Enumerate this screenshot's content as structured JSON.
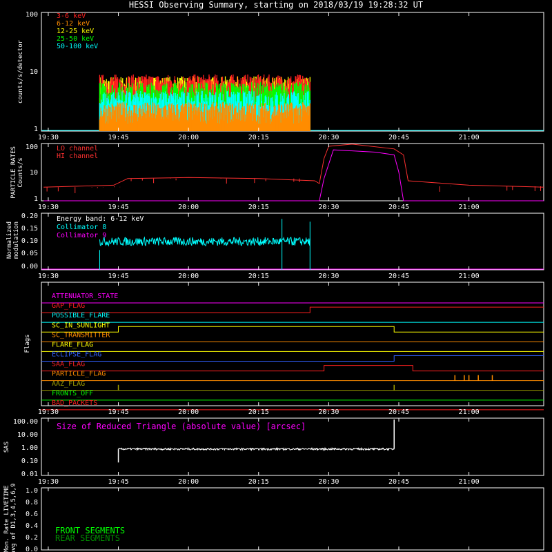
{
  "title": "HESSI Observing Summary, starting on 2018/03/19 19:28:32 UT",
  "time_ticks": [
    "19:30",
    "19:45",
    "20:00",
    "20:15",
    "20:30",
    "20:45",
    "21:00"
  ],
  "chart_data": [
    {
      "type": "line",
      "panel": "count-rates",
      "ylabel": "counts/s/detector",
      "yscale": "log",
      "ylim": [
        1,
        100
      ],
      "yticks": [
        "100",
        "10",
        "1"
      ],
      "x_range": [
        "19:28:32",
        "21:16"
      ],
      "series": [
        {
          "name": "3-6 keV",
          "color": "#ff2020",
          "start": "19:41",
          "end": "20:26",
          "typical": 6.5,
          "max": 9
        },
        {
          "name": "6-12 keV",
          "color": "#ff8c00",
          "start": "19:41",
          "end": "20:26",
          "typical": 2.2,
          "max": 4
        },
        {
          "name": "12-25 keV",
          "color": "#ffff00",
          "start": "19:41",
          "end": "20:26",
          "typical": 6.0,
          "max": 9
        },
        {
          "name": "25-50 keV",
          "color": "#00ff00",
          "start": "19:41",
          "end": "20:26",
          "typical": 4.8,
          "max": 7
        },
        {
          "name": "50-100 keV",
          "color": "#00ffff",
          "start": "19:41",
          "end": "20:26",
          "typical": 3.4,
          "max": 5
        }
      ]
    },
    {
      "type": "line",
      "panel": "particle-rates",
      "ylabel": "PARTICLE RATES Counts/s",
      "yscale": "log",
      "ylim": [
        1,
        100
      ],
      "yticks": [
        "100",
        "10",
        "1"
      ],
      "series": [
        {
          "name": "LO channel",
          "color": "#ff3030",
          "points": [
            [
              "19:29",
              3
            ],
            [
              "19:44",
              3.5
            ],
            [
              "19:47",
              6
            ],
            [
              "20:00",
              6.5
            ],
            [
              "20:15",
              6
            ],
            [
              "20:27",
              5
            ],
            [
              "20:28",
              4
            ],
            [
              "20:29",
              30
            ],
            [
              "20:30",
              80
            ],
            [
              "20:35",
              95
            ],
            [
              "20:44",
              65
            ],
            [
              "20:46",
              40
            ],
            [
              "20:47",
              5
            ],
            [
              "21:00",
              3.5
            ],
            [
              "21:16",
              3
            ]
          ]
        },
        {
          "name": "HI channel",
          "color": "#ff00ff",
          "points": [
            [
              "19:29",
              1
            ],
            [
              "20:28",
              1
            ],
            [
              "20:29",
              6
            ],
            [
              "20:31",
              60
            ],
            [
              "20:40",
              50
            ],
            [
              "20:44",
              40
            ],
            [
              "20:45",
              10
            ],
            [
              "20:46",
              1
            ],
            [
              "21:16",
              1
            ]
          ]
        }
      ]
    },
    {
      "type": "line",
      "panel": "modulation",
      "ylabel": "Normalized modulation",
      "ylim": [
        0,
        0.2
      ],
      "yticks": [
        "0.20",
        "0.15",
        "0.10",
        "0.05",
        "0.00"
      ],
      "annotation": "Energy band: 6-12 keV",
      "series": [
        {
          "name": "Collimator 8",
          "color": "#00ffff",
          "start": "19:41",
          "end": "20:26",
          "typical": 0.1,
          "spikes": [
            [
              "19:41",
              0.07
            ],
            [
              "20:20",
              0.18
            ],
            [
              "20:26",
              0.17
            ]
          ]
        },
        {
          "name": "Collimator 9",
          "color": "#ff00ff",
          "level": 0.0
        }
      ]
    },
    {
      "type": "line",
      "panel": "flags",
      "ylabel": "Flags",
      "flags": [
        {
          "name": "ATTENUATOR_STATE",
          "color": "#ff00ff",
          "changes": []
        },
        {
          "name": "GAP_FLAG",
          "color": "#ff2020",
          "changes": [
            [
              "20:26",
              "up"
            ]
          ]
        },
        {
          "name": "POSSIBLE_FLARE",
          "color": "#00ffff",
          "changes": []
        },
        {
          "name": "SC_IN_SUNLIGHT",
          "color": "#ffff00",
          "changes": [
            [
              "19:45",
              "up"
            ],
            [
              "20:44",
              "down"
            ]
          ]
        },
        {
          "name": "SC_TRANSMITTER",
          "color": "#ff8c00",
          "changes": []
        },
        {
          "name": "FLARE_FLAG",
          "color": "#ffff00",
          "changes": []
        },
        {
          "name": "ECLIPSE_FLAG",
          "color": "#3060ff",
          "changes": [
            [
              "19:45",
              "down"
            ],
            [
              "20:44",
              "up"
            ]
          ]
        },
        {
          "name": "SAA_FLAG",
          "color": "#ff2020",
          "changes": [
            [
              "20:29",
              "up"
            ],
            [
              "20:48",
              "down"
            ]
          ]
        },
        {
          "name": "PARTICLE_FLAG",
          "color": "#ff8c00",
          "spikes": [
            "20:57",
            "20:59",
            "21:00",
            "21:02",
            "21:05"
          ]
        },
        {
          "name": "AAZ_FLAG",
          "color": "#a0a000",
          "spikes": [
            "19:45",
            "20:44"
          ]
        },
        {
          "name": "FRONTS_OFF",
          "color": "#00ff00",
          "changes": []
        },
        {
          "name": "BAD_PACKETS",
          "color": "#ff2020",
          "changes": []
        }
      ]
    },
    {
      "type": "line",
      "panel": "sas",
      "ylabel": "SAS",
      "yscale": "log",
      "ylim": [
        0.01,
        100
      ],
      "yticks": [
        "100.00",
        "10.00",
        "1.00",
        "0.10",
        "0.01"
      ],
      "annotation": "Size of Reduced Triangle (absolute value) [arcsec]",
      "series": [
        {
          "name": "",
          "color": "#ffffff",
          "start": "19:45",
          "end": "20:44",
          "typical": 0.7,
          "spikes": [
            [
              "19:45",
              0.08
            ],
            [
              "20:44",
              80
            ]
          ]
        }
      ]
    },
    {
      "type": "line",
      "panel": "livetime",
      "ylabel": "Mon. Rate LIVETIME avg of D1,3,4,5,6,9",
      "ylim": [
        0,
        1
      ],
      "yticks": [
        "1.0",
        "0.8",
        "0.6",
        "0.4",
        "0.2",
        "0.0"
      ],
      "series": [
        {
          "name": "FRONT SEGMENTS",
          "color": "#00ff00"
        },
        {
          "name": "REAR SEGMENTS",
          "color": "#008f00"
        }
      ]
    }
  ]
}
